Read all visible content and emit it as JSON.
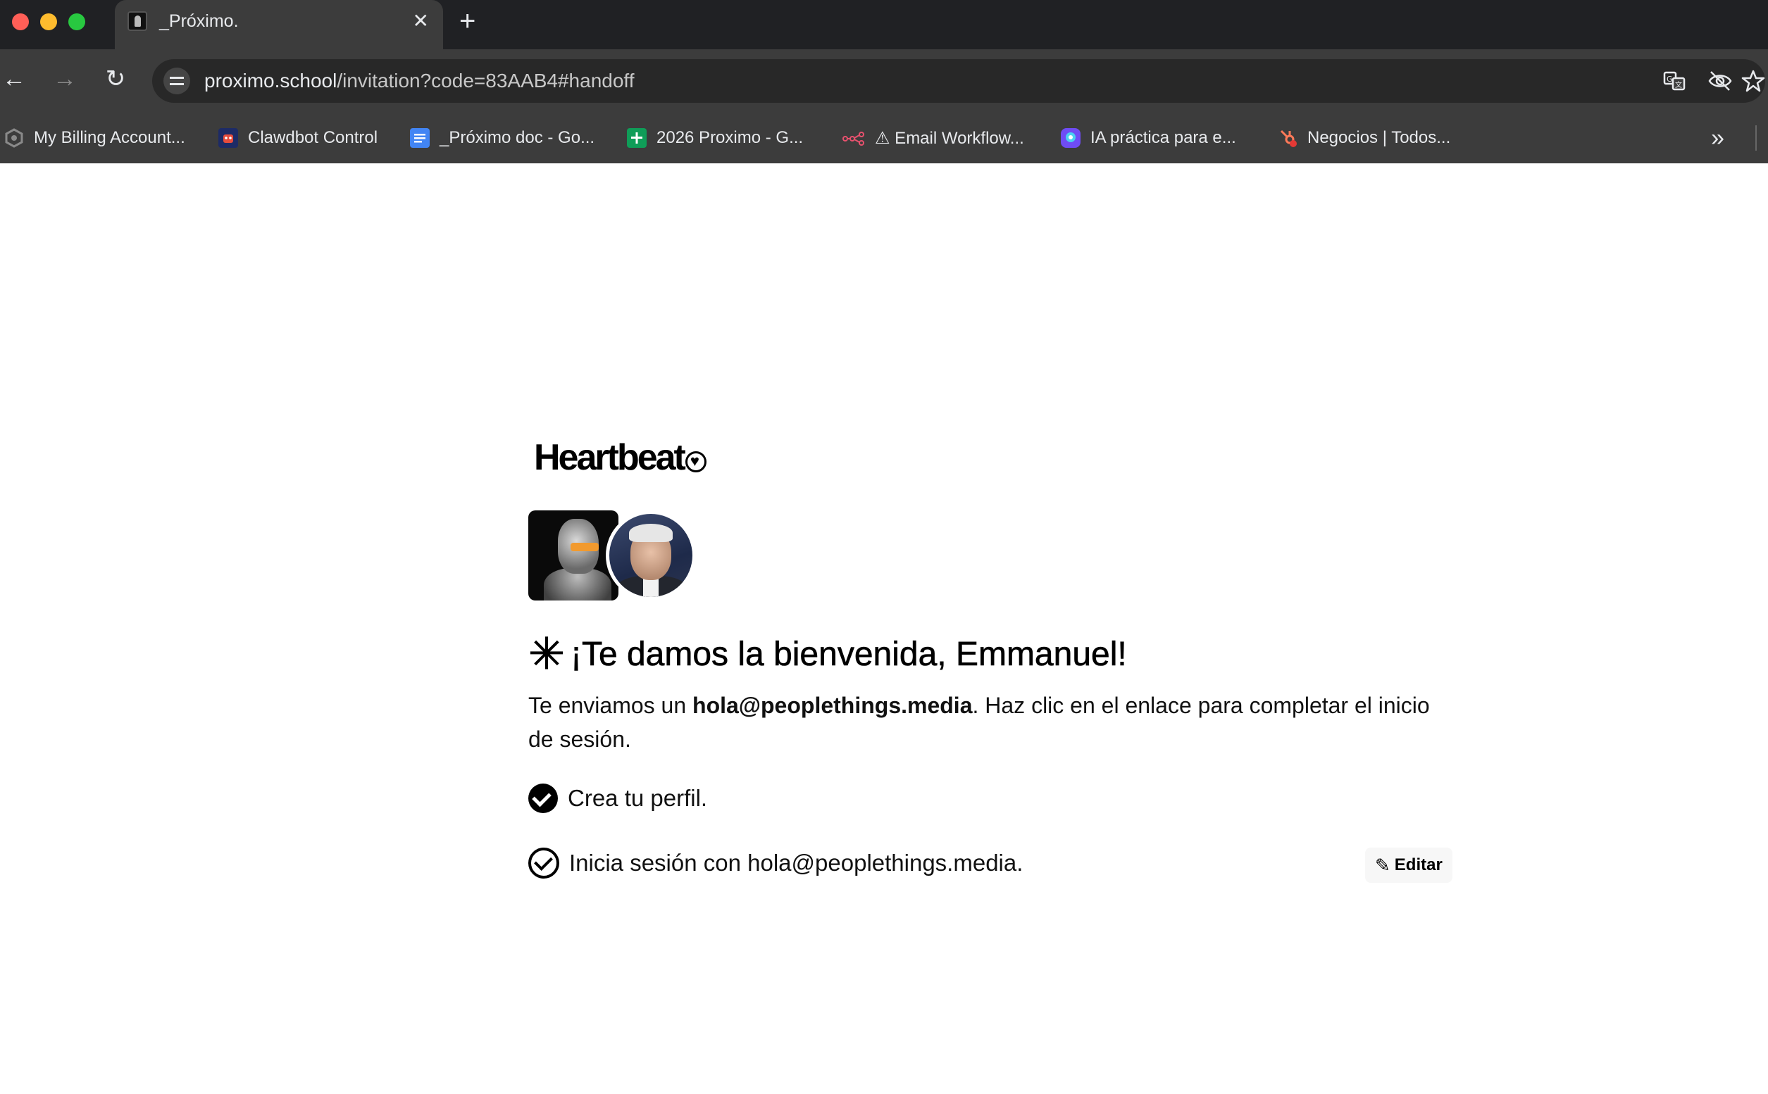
{
  "tab": {
    "title": "_Próximo.",
    "close_glyph": "✕",
    "new_tab_glyph": "+"
  },
  "toolbar": {
    "back_glyph": "←",
    "forward_glyph": "→",
    "reload_glyph": "↻",
    "url_host": "proximo.school",
    "url_path": "/invitation?code=83AAB4#handoff",
    "icons": [
      "site-info-icon",
      "translate-icon",
      "eye-off-icon",
      "star-icon"
    ]
  },
  "bookmarks": {
    "items": [
      {
        "label": "My Billing Account...",
        "icon": "billing-icon",
        "color": "#8a8a8a"
      },
      {
        "label": "Clawdbot Control",
        "icon": "clawdbot-icon",
        "color": "#2b4aa8"
      },
      {
        "label": "_Próximo doc - Go...",
        "icon": "google-docs-icon",
        "color": "#4285f4"
      },
      {
        "label": "2026 Proximo - G...",
        "icon": "google-sheets-icon",
        "color": "#0f9d58"
      },
      {
        "label": "⚠ Email Workflow...",
        "icon": "workflow-icon",
        "color": "#e8516e"
      },
      {
        "label": "IA práctica para e...",
        "icon": "ia-icon",
        "color": "#6f4cf5"
      },
      {
        "label": "Negocios | Todos...",
        "icon": "hubspot-icon",
        "color": "#ff7a59"
      }
    ],
    "more_glyph": "»"
  },
  "page": {
    "logo": "Heartbeat",
    "heading_glyph": "✳",
    "heading": "¡Te damos la bienvenida, Emmanuel!",
    "desc_prefix": "Te enviamos un ",
    "desc_email": "hola@peoplethings.media",
    "desc_suffix": ". Haz clic en el enlace para completar el inicio de sesión.",
    "step1": "Crea tu perfil.",
    "step2": "Inicia sesión con hola@peoplethings.media.",
    "edit_glyph": "✎",
    "edit_label": "Editar"
  },
  "colors": {
    "chrome_dark": "#202124",
    "chrome": "#3c3c3c",
    "omnibox": "#282828",
    "text_light": "#e8eaed",
    "close_red": "#ff5f57",
    "minimize_yellow": "#febc2e",
    "maximize_green": "#28c840"
  }
}
